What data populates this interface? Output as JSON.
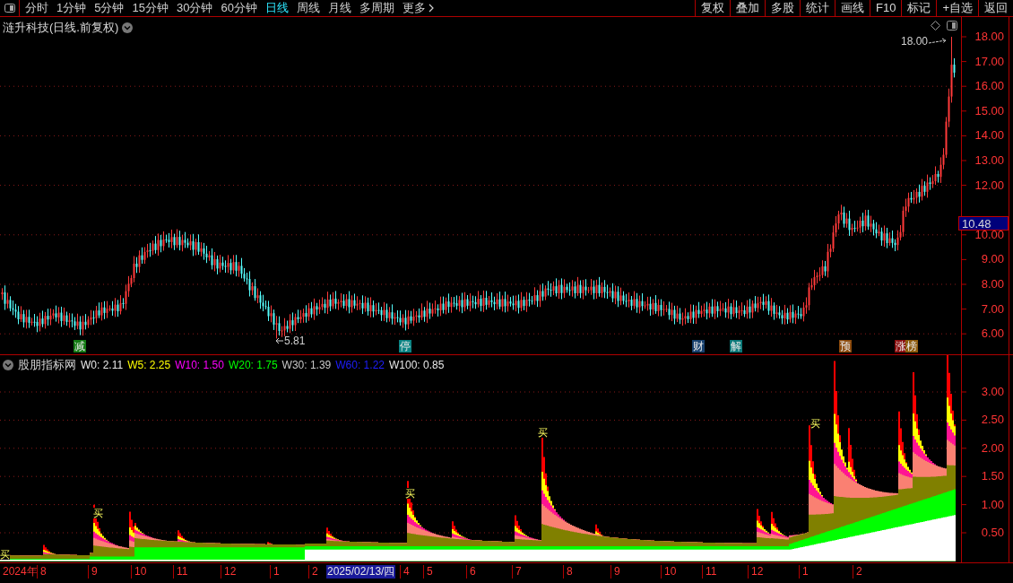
{
  "toolbar": {
    "periods": [
      {
        "label": "分时",
        "selected": false
      },
      {
        "label": "1分钟",
        "selected": false
      },
      {
        "label": "5分钟",
        "selected": false
      },
      {
        "label": "15分钟",
        "selected": false
      },
      {
        "label": "30分钟",
        "selected": false
      },
      {
        "label": "60分钟",
        "selected": false
      },
      {
        "label": "日线",
        "selected": true
      },
      {
        "label": "周线",
        "selected": false
      },
      {
        "label": "月线",
        "selected": false
      },
      {
        "label": "多周期",
        "selected": false
      },
      {
        "label": "更多",
        "selected": false
      }
    ],
    "actions": [
      "复权",
      "叠加",
      "多股",
      "统计",
      "画线",
      "F10",
      "标记",
      "+自选",
      "返回"
    ]
  },
  "main_chart": {
    "title": "涟升科技(日线.前复权)",
    "price_axis": [
      "18.00",
      "17.00",
      "16.00",
      "15.00",
      "14.00",
      "13.00",
      "12.00",
      "10.00",
      "9.00",
      "8.00",
      "7.00",
      "6.00"
    ],
    "current_price": "10.48",
    "high_label": "18.00",
    "low_label": "5.81",
    "events": [
      {
        "label": "减",
        "color": "#137a13"
      },
      {
        "label": "停",
        "color": "#0a8484"
      },
      {
        "label": "财",
        "color": "#17406e"
      },
      {
        "label": "解",
        "color": "#0a7878"
      },
      {
        "label": "预",
        "color": "#8c4a0c"
      },
      {
        "label": "涨",
        "color": "#8c1010"
      },
      {
        "label": "榜",
        "color": "#8c5a0c"
      }
    ]
  },
  "indicator": {
    "name": "股朋指标网",
    "legend": [
      {
        "label": "W0: 2.11",
        "color": "#e8e8e8"
      },
      {
        "label": "W5: 2.25",
        "color": "#ffff00"
      },
      {
        "label": "W10: 1.50",
        "color": "#ff00ff"
      },
      {
        "label": "W20: 1.75",
        "color": "#00ff00"
      },
      {
        "label": "W30: 1.39",
        "color": "#c8c8c8"
      },
      {
        "label": "W60: 1.22",
        "color": "#1e1eff"
      },
      {
        "label": "W100: 0.85",
        "color": "#e8e8e8"
      }
    ],
    "axis": [
      "3.00",
      "2.50",
      "2.00",
      "1.50",
      "1.00",
      "0.50"
    ],
    "signals": [
      "买",
      "买",
      "买",
      "买",
      "买"
    ]
  },
  "date_axis": [
    {
      "label": "2024年",
      "selected": false
    },
    {
      "label": "8",
      "selected": false
    },
    {
      "label": "9",
      "selected": false
    },
    {
      "label": "10",
      "selected": false
    },
    {
      "label": "11",
      "selected": false
    },
    {
      "label": "12",
      "selected": false
    },
    {
      "label": "1",
      "selected": false
    },
    {
      "label": "2",
      "selected": false
    },
    {
      "label": "2025/02/13/四",
      "selected": true
    },
    {
      "label": "4",
      "selected": false
    },
    {
      "label": "5",
      "selected": false
    },
    {
      "label": "6",
      "selected": false
    },
    {
      "label": "7",
      "selected": false
    },
    {
      "label": "8",
      "selected": false
    },
    {
      "label": "9",
      "selected": false
    },
    {
      "label": "10",
      "selected": false
    },
    {
      "label": "11",
      "selected": false
    },
    {
      "label": "12",
      "selected": false
    },
    {
      "label": "1",
      "selected": false
    },
    {
      "label": "2",
      "selected": false
    }
  ]
}
